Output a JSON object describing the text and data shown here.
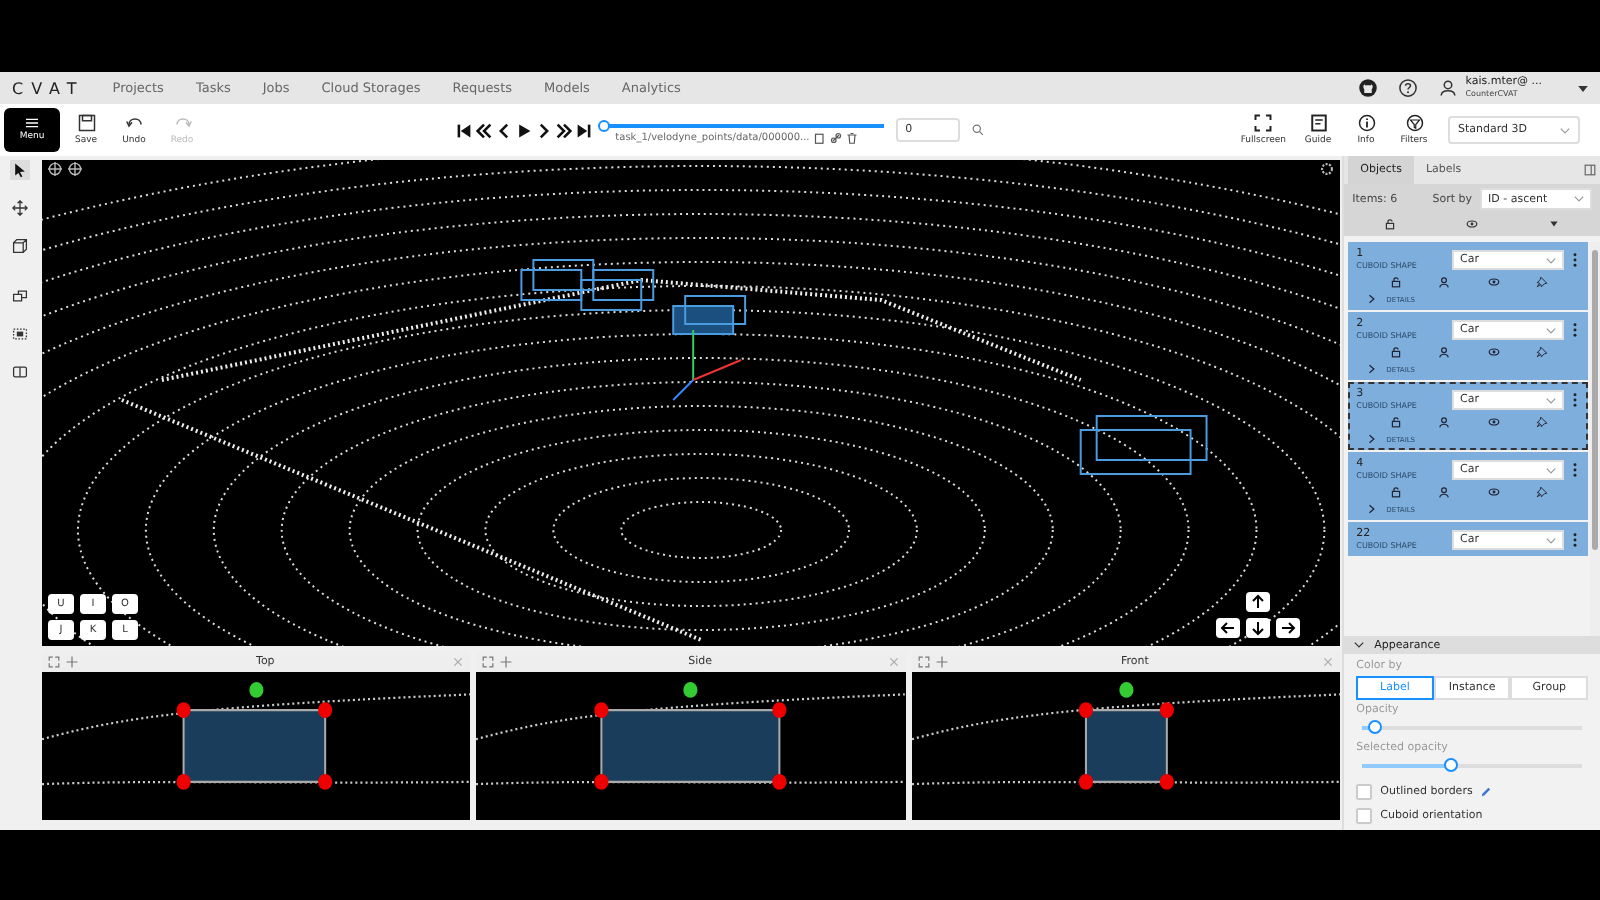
{
  "nav": {
    "logo": "CVAT",
    "links": [
      "Projects",
      "Tasks",
      "Jobs",
      "Cloud Storages",
      "Requests",
      "Models",
      "Analytics"
    ],
    "user": {
      "name": "kais.mter@ ...",
      "org": "CounterCVAT"
    }
  },
  "toolbar": {
    "menu": "Menu",
    "actions": [
      {
        "kind": "save",
        "label": "Save",
        "disabled": false
      },
      {
        "kind": "undo",
        "label": "Undo",
        "disabled": false
      },
      {
        "kind": "redo",
        "label": "Redo",
        "disabled": true
      }
    ],
    "frame_path": "task_1/velodyne_points/data/000000...",
    "frame_slider": {
      "level": 0.0
    },
    "frame_number": "0",
    "tools": [
      {
        "kind": "fullscreen",
        "label": "Fullscreen"
      },
      {
        "kind": "guide",
        "label": "Guide"
      },
      {
        "kind": "info",
        "label": "Info"
      },
      {
        "kind": "filters",
        "label": "Filters"
      }
    ],
    "workspace": "Standard 3D"
  },
  "canvas": {
    "keys": [
      [
        "U",
        "I",
        "O"
      ],
      [
        "J",
        "K",
        "L"
      ]
    ]
  },
  "views": [
    {
      "title": "Top"
    },
    {
      "title": "Side"
    },
    {
      "title": "Front"
    }
  ],
  "sidebar": {
    "tabs": [
      {
        "label": "Objects",
        "selected": true
      },
      {
        "label": "Labels",
        "selected": false
      }
    ],
    "items_count": "Items: 6",
    "sort_label": "Sort by",
    "sort_value": "ID - ascent",
    "objects": [
      {
        "id": "1",
        "type": "CUBOID SHAPE",
        "label": "Car",
        "details": "DETAILS",
        "active": false
      },
      {
        "id": "2",
        "type": "CUBOID SHAPE",
        "label": "Car",
        "details": "DETAILS",
        "active": false
      },
      {
        "id": "3",
        "type": "CUBOID SHAPE",
        "label": "Car",
        "details": "DETAILS",
        "active": true
      },
      {
        "id": "4",
        "type": "CUBOID SHAPE",
        "label": "Car",
        "details": "DETAILS",
        "active": false
      },
      {
        "id": "22",
        "type": "CUBOID SHAPE",
        "label": "Car",
        "active": false
      }
    ],
    "appearance": {
      "title": "Appearance",
      "color_by": "Color by",
      "options": [
        {
          "label": "Label",
          "selected": true
        },
        {
          "label": "Instance",
          "selected": false
        },
        {
          "label": "Group",
          "selected": false
        }
      ],
      "opacity": {
        "label": "Opacity",
        "level": 0.05
      },
      "selected_opacity": {
        "label": "Selected opacity",
        "level": 0.4
      },
      "checks": [
        {
          "label": "Outlined borders",
          "checked": false
        },
        {
          "label": "Cuboid orientation",
          "checked": false
        }
      ]
    }
  }
}
